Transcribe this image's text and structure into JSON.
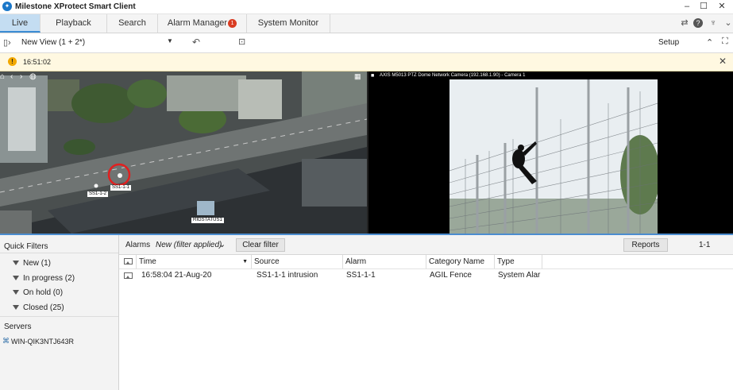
{
  "app": {
    "title": "Milestone XProtect Smart Client"
  },
  "tabs": [
    {
      "label": "Live",
      "active": true
    },
    {
      "label": "Playback"
    },
    {
      "label": "Search"
    },
    {
      "label": "Alarm Manager",
      "badge": "1"
    },
    {
      "label": "System Monitor"
    }
  ],
  "toolbar": {
    "view_name": "New View (1 + 2*)",
    "setup_label": "Setup"
  },
  "notification": {
    "time": "16:51:02"
  },
  "map": {
    "labels": [
      "SS1-1-1",
      "SS1-1-2",
      "RIGSTATUS1"
    ]
  },
  "camera": {
    "title": "AXIS M5013 PTZ Dome Network Camera (192.168.1.90) - Camera 1"
  },
  "quick_filters": {
    "title": "Quick Filters",
    "items": [
      {
        "label": "New (1)"
      },
      {
        "label": "In progress (2)"
      },
      {
        "label": "On hold (0)"
      },
      {
        "label": "Closed (25)"
      }
    ],
    "servers_title": "Servers",
    "server": "WIN-QIK3NTJ643R"
  },
  "alarms": {
    "label": "Alarms",
    "filter": "New (filter applied)",
    "clear_filter": "Clear filter",
    "reports": "Reports",
    "range": "1-1",
    "columns": [
      "Time",
      "Source",
      "Alarm",
      "Category Name",
      "Type"
    ],
    "rows": [
      {
        "time": "16:58:04 21-Aug-20",
        "source": "SS1-1-1 intrusion",
        "alarm": "SS1-1-1",
        "category": "AGIL Fence",
        "type": "System Alarm"
      }
    ]
  },
  "colors": {
    "accent": "#3b8bd3",
    "alarm_circle": "#e02020",
    "badge": "#d93c22"
  }
}
